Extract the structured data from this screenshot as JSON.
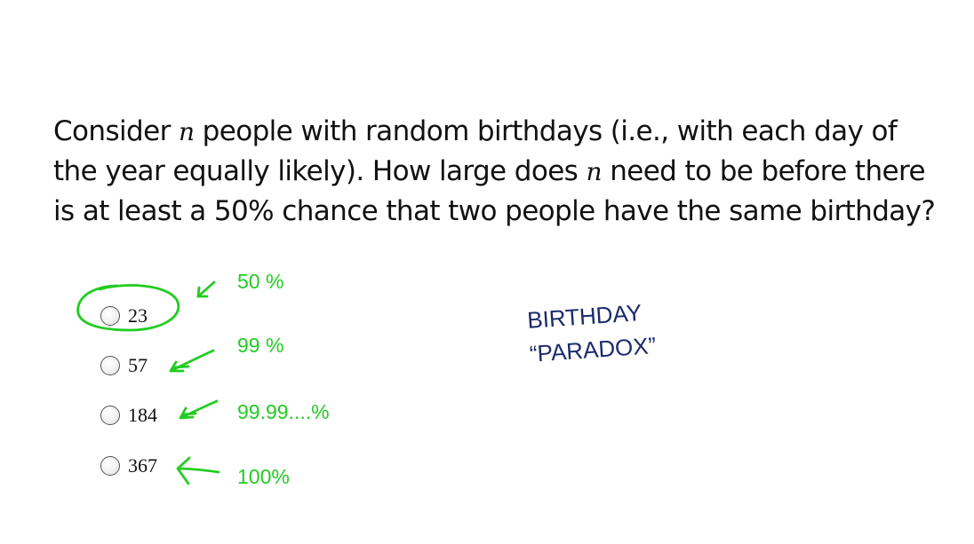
{
  "question": {
    "line1": {
      "a": "Consider ",
      "var": "n",
      "b": " people with random birthdays (i.e., with each day of"
    },
    "line2": {
      "a": "the year equally likely).  How large does ",
      "var": "n",
      "b": " need to be before there"
    },
    "line3": "is at least a 50% chance that two people have the same birthday?"
  },
  "options": [
    {
      "label": "23",
      "selected": false
    },
    {
      "label": "57",
      "selected": false
    },
    {
      "label": "184",
      "selected": false
    },
    {
      "label": "367",
      "selected": false
    }
  ],
  "annotations": {
    "percentages": [
      "50 %",
      "99 %",
      "99.99....%",
      "100%"
    ],
    "paradox_line1": "BIRTHDAY",
    "paradox_line2": "“PARADOX”",
    "ink_color": "#22cc22",
    "paradox_color": "#1b2a6b"
  }
}
